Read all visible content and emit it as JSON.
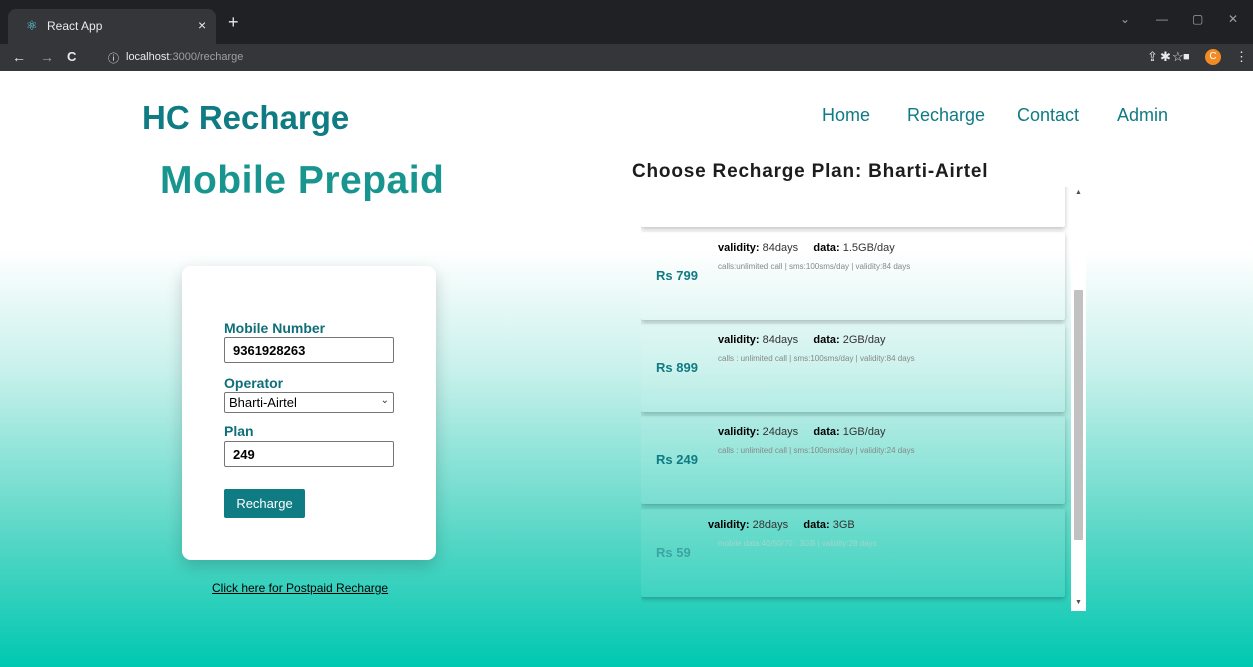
{
  "browser": {
    "tab_title": "React App",
    "tab_favicon": "react-icon",
    "tab_close": "×",
    "new_tab": "+",
    "url_host": "localhost",
    "url_path": ":3000/recharge",
    "back": "←",
    "forward": "→",
    "reload": "C",
    "info": "ⓘ",
    "share": "⇪",
    "star": "☆",
    "extensions": "✱",
    "sidepanel": "■",
    "profile_initial": "C",
    "menu": "⋮",
    "minimize": "—",
    "maximize": "▢",
    "close": "✕",
    "chevron": "⌄"
  },
  "header": {
    "brand": "HC Recharge",
    "nav": [
      "Home",
      "Recharge",
      "Contact",
      "Admin"
    ]
  },
  "main": {
    "heading": "Mobile Prepaid",
    "form": {
      "mobile_label": "Mobile Number",
      "mobile_value": "9361928263",
      "operator_label": "Operator",
      "operator_value": "Bharti-Airtel",
      "plan_label": "Plan",
      "plan_value": "249",
      "submit_label": "Recharge"
    },
    "postpaid_link": "Click here for Postpaid Recharge"
  },
  "plans": {
    "title": "Choose Recharge Plan: Bharti-Airtel",
    "validity_label": "validity:",
    "data_label": "data:",
    "items": [
      {
        "price": "Rs 799",
        "validity": "84days",
        "data": "1.5GB/day",
        "desc": "calls:unlimited call | sms:100sms/day | validity:84 days"
      },
      {
        "price": "Rs 899",
        "validity": "84days",
        "data": "2GB/day",
        "desc": "calls : unlimited call | sms:100sms/day | validity:84 days"
      },
      {
        "price": "Rs 249",
        "validity": "24days",
        "data": "1GB/day",
        "desc": "calls : unlimited call | sms:100sms/day | validity:24 days"
      },
      {
        "price": "Rs 59",
        "validity": "28days",
        "data": "3GB",
        "desc": "mobile data:40/50/70 : 3GB | validity:28 days"
      }
    ]
  },
  "colors": {
    "brand": "#0f7b82",
    "heading": "#19958f",
    "gradient_bottom": "#00c8b1"
  }
}
